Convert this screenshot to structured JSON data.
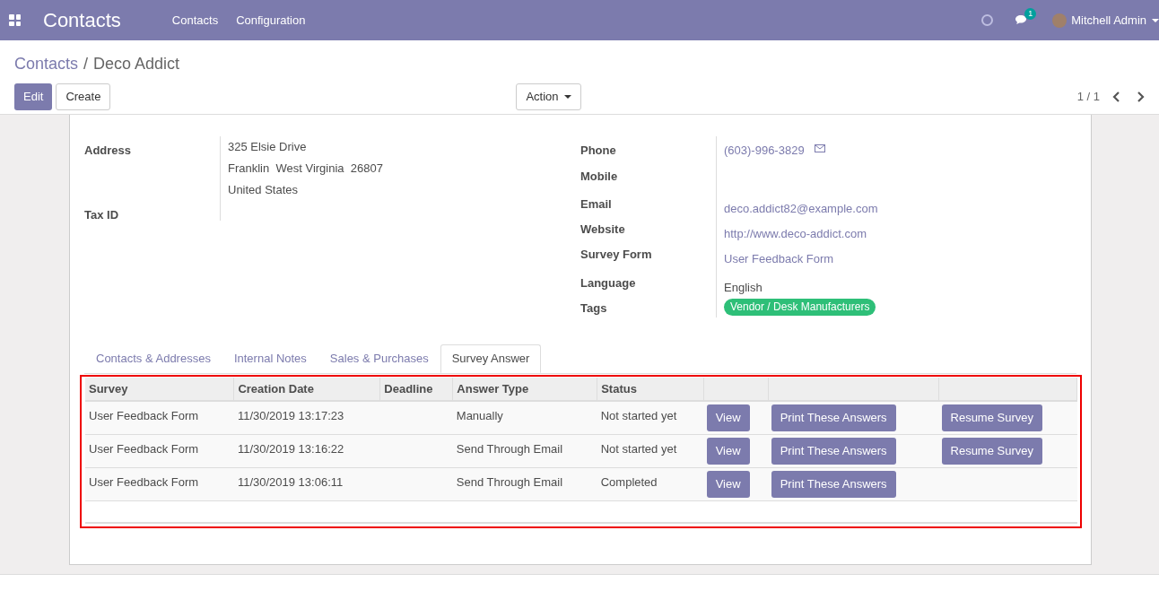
{
  "navbar": {
    "app_title": "Contacts",
    "menu": [
      "Contacts",
      "Configuration"
    ],
    "message_count": "1",
    "user": "Mitchell Admin"
  },
  "breadcrumb": {
    "parent": "Contacts",
    "separator": "/",
    "current": "Deco Addict"
  },
  "buttons": {
    "edit": "Edit",
    "create": "Create",
    "action": "Action"
  },
  "pager": "1 / 1",
  "left_fields": [
    {
      "label": "Address",
      "lines": [
        "325 Elsie Drive",
        "Franklin  West Virginia  26807",
        "United States"
      ]
    },
    {
      "label": "Tax ID"
    }
  ],
  "right_fields": [
    {
      "label": "Phone",
      "value": "(603)-996-3829",
      "kind": "phone"
    },
    {
      "label": "Mobile",
      "kind": "empty"
    },
    {
      "label": "Email",
      "value": "deco.addict82@example.com",
      "kind": "link"
    },
    {
      "label": "Website",
      "value": "http://www.deco-addict.com",
      "kind": "link"
    },
    {
      "label": "Survey Form",
      "value": "User Feedback Form",
      "kind": "link"
    },
    {
      "label": "Language",
      "value": "English",
      "kind": "text"
    },
    {
      "label": "Tags",
      "value": "Vendor / Desk Manufacturers",
      "kind": "tag",
      "color": "#2ebf78"
    }
  ],
  "tabs": [
    {
      "label": "Contacts & Addresses",
      "selected": false
    },
    {
      "label": "Internal Notes",
      "selected": false
    },
    {
      "label": "Sales & Purchases",
      "selected": false
    },
    {
      "label": "Survey Answer",
      "selected": true
    }
  ],
  "table": {
    "columns": [
      "Survey",
      "Creation Date",
      "Deadline",
      "Answer Type",
      "Status"
    ],
    "rows": [
      {
        "survey": "User Feedback Form",
        "creation_date": "11/30/2019 13:17:23",
        "answer_type": "Manually",
        "status": "Not started yet",
        "view": "View",
        "print": "Print These Answers",
        "resume": "Resume Survey"
      },
      {
        "survey": "User Feedback Form",
        "creation_date": "11/30/2019 13:16:22",
        "answer_type": "Send Through Email",
        "status": "Not started yet",
        "view": "View",
        "print": "Print These Answers",
        "resume": "Resume Survey"
      },
      {
        "survey": "User Feedback Form",
        "creation_date": "11/30/2019 13:06:11",
        "answer_type": "Send Through Email",
        "status": "Completed",
        "view": "View",
        "print": "Print These Answers"
      }
    ]
  }
}
